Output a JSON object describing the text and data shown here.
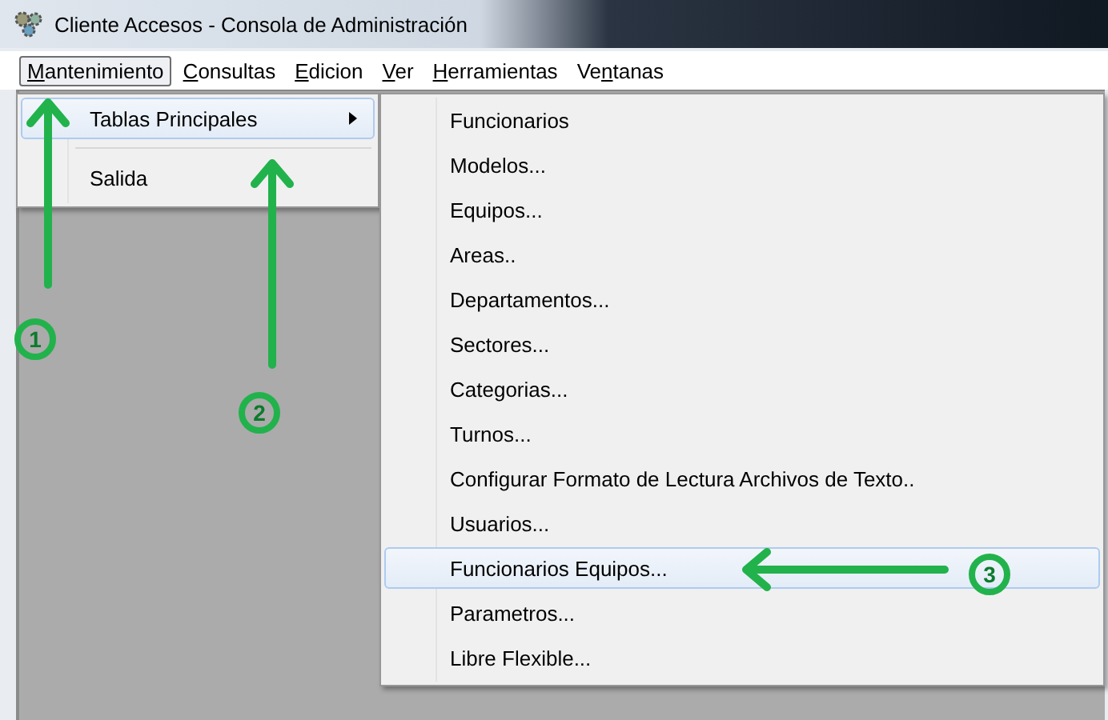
{
  "window": {
    "title": "Cliente Accesos - Consola de Administración"
  },
  "menu_bar": [
    {
      "label": {
        "key": "M",
        "after": "antenimiento"
      },
      "selected": true
    },
    {
      "label": {
        "key": "C",
        "after": "onsultas"
      },
      "selected": false
    },
    {
      "label": {
        "key": "E",
        "after": "dicion"
      },
      "selected": false
    },
    {
      "label": {
        "key": "V",
        "after": "er"
      },
      "selected": false
    },
    {
      "label": {
        "key": "H",
        "after": "erramientas"
      },
      "selected": false
    },
    {
      "label": {
        "before": "Ve",
        "key": "n",
        "after": "tanas"
      },
      "selected": false
    }
  ],
  "menu": {
    "items": [
      {
        "kind": "item",
        "label": "Tablas Principales",
        "submenu": true,
        "selected": true
      },
      {
        "kind": "separator"
      },
      {
        "kind": "item",
        "label": "Salida",
        "submenu": false,
        "selected": false
      }
    ]
  },
  "submenu": {
    "items": [
      {
        "label": "Funcionarios",
        "selected": false
      },
      {
        "label": "Modelos...",
        "selected": false
      },
      {
        "label": "Equipos...",
        "selected": false
      },
      {
        "label": "Areas..",
        "selected": false
      },
      {
        "label": "Departamentos...",
        "selected": false
      },
      {
        "label": "Sectores...",
        "selected": false
      },
      {
        "label": "Categorias...",
        "selected": false
      },
      {
        "label": "Turnos...",
        "selected": false
      },
      {
        "label": "Configurar Formato de Lectura Archivos de Texto..",
        "selected": false
      },
      {
        "label": "Usuarios...",
        "selected": false
      },
      {
        "label": "Funcionarios Equipos...",
        "selected": true
      },
      {
        "label": "Parametros...",
        "selected": false
      },
      {
        "label": "Libre Flexible...",
        "selected": false
      }
    ]
  },
  "annotations": [
    {
      "number": "1"
    },
    {
      "number": "2"
    },
    {
      "number": "3"
    }
  ]
}
